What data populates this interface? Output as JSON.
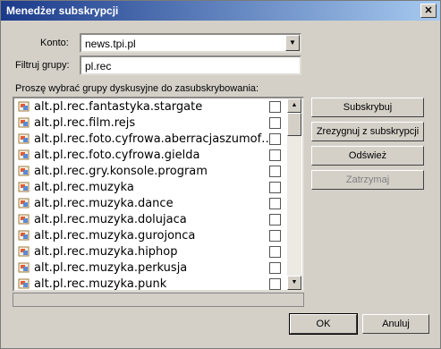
{
  "window": {
    "title": "Menedżer subskrypcji",
    "close_glyph": "✕"
  },
  "account": {
    "label": "Konto:",
    "value": "news.tpi.pl",
    "dropdown_glyph": "▼"
  },
  "filter": {
    "label": "Filtruj grupy:",
    "value": "pl.rec"
  },
  "list": {
    "instruction": "Proszę wybrać grupy dyskusyjne do zasubskrybowania:",
    "items": [
      {
        "name": "alt.pl.rec.fantastyka.stargate",
        "checked": false
      },
      {
        "name": "alt.pl.rec.film.rejs",
        "checked": false
      },
      {
        "name": "alt.pl.rec.foto.cyfrowa.aberracjaszumof…",
        "checked": false
      },
      {
        "name": "alt.pl.rec.foto.cyfrowa.gielda",
        "checked": false
      },
      {
        "name": "alt.pl.rec.gry.konsole.program",
        "checked": false
      },
      {
        "name": "alt.pl.rec.muzyka",
        "checked": false
      },
      {
        "name": "alt.pl.rec.muzyka.dance",
        "checked": false
      },
      {
        "name": "alt.pl.rec.muzyka.dolujaca",
        "checked": false
      },
      {
        "name": "alt.pl.rec.muzyka.gurojonca",
        "checked": false
      },
      {
        "name": "alt.pl.rec.muzyka.hiphop",
        "checked": false
      },
      {
        "name": "alt.pl.rec.muzyka.perkusja",
        "checked": false
      },
      {
        "name": "alt.pl.rec.muzyka.punk",
        "checked": false
      }
    ],
    "item_icon": "newsgroup-folder-icon",
    "scroll_up_glyph": "▲",
    "scroll_down_glyph": "▼"
  },
  "buttons": {
    "subscribe": "Subskrybuj",
    "unsubscribe": "Zrezygnuj z subskrypcji",
    "refresh": "Odśwież",
    "stop": "Zatrzymaj",
    "ok": "OK",
    "cancel": "Anuluj"
  },
  "colors": {
    "titlebar_start": "#1b3a8a",
    "titlebar_end": "#a6caf0",
    "face": "#d4d0c8",
    "disabled_text": "#808080"
  }
}
